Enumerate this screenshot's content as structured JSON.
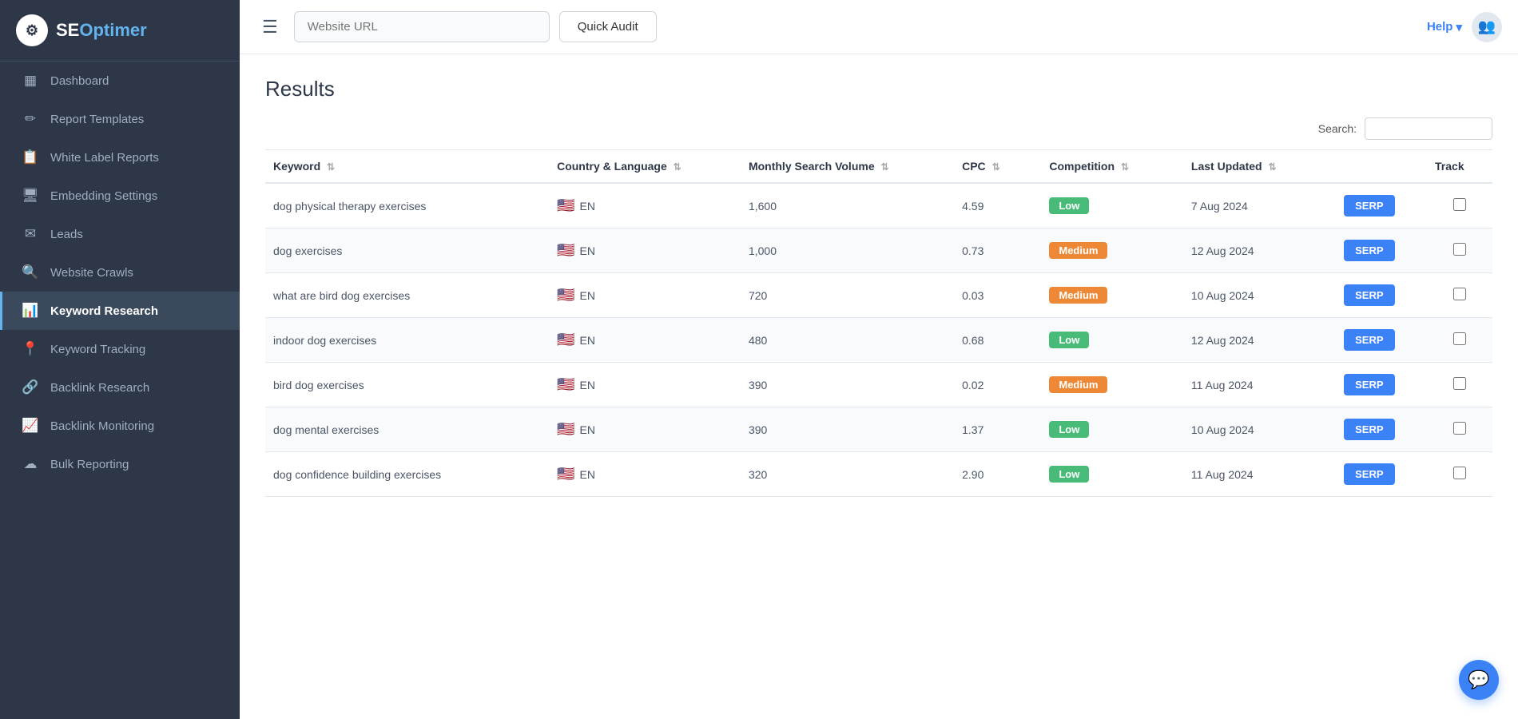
{
  "sidebar": {
    "logo_text": "SEOptimer",
    "logo_symbol": "⚙",
    "items": [
      {
        "id": "dashboard",
        "label": "Dashboard",
        "icon": "▦",
        "active": false
      },
      {
        "id": "report-templates",
        "label": "Report Templates",
        "icon": "✏",
        "active": false
      },
      {
        "id": "white-label-reports",
        "label": "White Label Reports",
        "icon": "📋",
        "active": false
      },
      {
        "id": "embedding-settings",
        "label": "Embedding Settings",
        "icon": "🖥",
        "active": false
      },
      {
        "id": "leads",
        "label": "Leads",
        "icon": "✉",
        "active": false
      },
      {
        "id": "website-crawls",
        "label": "Website Crawls",
        "icon": "🔍",
        "active": false
      },
      {
        "id": "keyword-research",
        "label": "Keyword Research",
        "icon": "📊",
        "active": true
      },
      {
        "id": "keyword-tracking",
        "label": "Keyword Tracking",
        "icon": "📍",
        "active": false
      },
      {
        "id": "backlink-research",
        "label": "Backlink Research",
        "icon": "🔗",
        "active": false
      },
      {
        "id": "backlink-monitoring",
        "label": "Backlink Monitoring",
        "icon": "📈",
        "active": false
      },
      {
        "id": "bulk-reporting",
        "label": "Bulk Reporting",
        "icon": "☁",
        "active": false
      }
    ]
  },
  "topbar": {
    "url_placeholder": "Website URL",
    "quick_audit_label": "Quick Audit",
    "help_label": "Help",
    "help_chevron": "▾"
  },
  "content": {
    "results_title": "Results",
    "search_label": "Search:",
    "search_value": "",
    "table": {
      "columns": [
        {
          "id": "keyword",
          "label": "Keyword",
          "sortable": true
        },
        {
          "id": "country",
          "label": "Country & Language",
          "sortable": true
        },
        {
          "id": "msv",
          "label": "Monthly Search Volume",
          "sortable": true
        },
        {
          "id": "cpc",
          "label": "CPC",
          "sortable": true
        },
        {
          "id": "competition",
          "label": "Competition",
          "sortable": true
        },
        {
          "id": "updated",
          "label": "Last Updated",
          "sortable": true
        },
        {
          "id": "serp",
          "label": "",
          "sortable": false
        },
        {
          "id": "track",
          "label": "Track",
          "sortable": false
        }
      ],
      "rows": [
        {
          "keyword": "dog physical therapy exercises",
          "country": "EN",
          "msv": "1,600",
          "cpc": "4.59",
          "competition": "Low",
          "competition_level": "low",
          "updated": "7 Aug 2024",
          "serp_label": "SERP"
        },
        {
          "keyword": "dog exercises",
          "country": "EN",
          "msv": "1,000",
          "cpc": "0.73",
          "competition": "Medium",
          "competition_level": "medium",
          "updated": "12 Aug 2024",
          "serp_label": "SERP"
        },
        {
          "keyword": "what are bird dog exercises",
          "country": "EN",
          "msv": "720",
          "cpc": "0.03",
          "competition": "Medium",
          "competition_level": "medium",
          "updated": "10 Aug 2024",
          "serp_label": "SERP"
        },
        {
          "keyword": "indoor dog exercises",
          "country": "EN",
          "msv": "480",
          "cpc": "0.68",
          "competition": "Low",
          "competition_level": "low",
          "updated": "12 Aug 2024",
          "serp_label": "SERP"
        },
        {
          "keyword": "bird dog exercises",
          "country": "EN",
          "msv": "390",
          "cpc": "0.02",
          "competition": "Medium",
          "competition_level": "medium",
          "updated": "11 Aug 2024",
          "serp_label": "SERP"
        },
        {
          "keyword": "dog mental exercises",
          "country": "EN",
          "msv": "390",
          "cpc": "1.37",
          "competition": "Low",
          "competition_level": "low",
          "updated": "10 Aug 2024",
          "serp_label": "SERP"
        },
        {
          "keyword": "dog confidence building exercises",
          "country": "EN",
          "msv": "320",
          "cpc": "2.90",
          "competition": "Low",
          "competition_level": "low",
          "updated": "11 Aug 2024",
          "serp_label": "SERP"
        }
      ]
    }
  },
  "chat": {
    "icon": "💬"
  }
}
